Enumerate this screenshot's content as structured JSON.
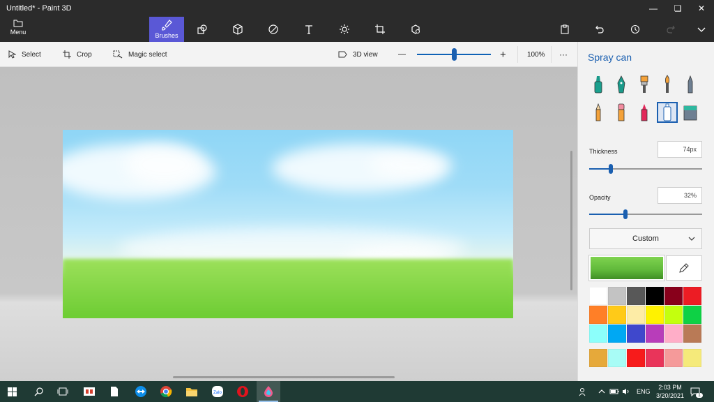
{
  "window": {
    "title": "Untitled* - Paint 3D",
    "controls": [
      "minimize",
      "restore",
      "close"
    ]
  },
  "ribbon": {
    "menu_label": "Menu",
    "active_tool_label": "Brushes",
    "tools": [
      "brush-icon",
      "2d-shapes-icon",
      "3d-shapes-icon",
      "stickers-icon",
      "text-icon",
      "effects-icon",
      "canvas-icon",
      "3d-library-icon"
    ],
    "right_tools": [
      "paste-icon",
      "undo-icon",
      "history-icon",
      "redo-icon",
      "expand-icon"
    ]
  },
  "subbar": {
    "select_label": "Select",
    "crop_label": "Crop",
    "magic_select_label": "Magic select",
    "view3d_label": "3D view",
    "zoom_minus": "—",
    "zoom_plus": "+",
    "zoom_level": "100%",
    "zoom_slider_fraction": 0.5,
    "more": "···"
  },
  "panel": {
    "title": "Spray can",
    "brushes": [
      "marker",
      "calligraphy-pen",
      "oil-brush",
      "watercolor",
      "pixel-pen",
      "pencil",
      "eraser",
      "crayon",
      "spray-can",
      "fill"
    ],
    "selected_brush": "spray-can",
    "thickness_label": "Thickness",
    "thickness_value": "74px",
    "thickness_fraction": 0.19,
    "opacity_label": "Opacity",
    "opacity_value": "32%",
    "opacity_fraction": 0.32,
    "color_mode": "Custom",
    "current_color": "#5fb83a",
    "palette": [
      "#ffffff",
      "#c3c3c3",
      "#585858",
      "#000000",
      "#88001b",
      "#ec1c24",
      "#ff7f27",
      "#ffca18",
      "#fdeca6",
      "#fff200",
      "#c4ff0e",
      "#0ed145",
      "#8cfffb",
      "#00a8f3",
      "#3f48cc",
      "#b83dba",
      "#ffaec8",
      "#b97a56"
    ],
    "custom_palette": [
      "#e6a93a",
      "#a8fcf6",
      "#f71b1b",
      "#e9345a",
      "#f59a9a",
      "#f5ea7a"
    ]
  },
  "taskbar": {
    "apps": [
      "windows-start-icon",
      "search-icon",
      "task-view-icon",
      "app-icon",
      "file-icon",
      "teamviewer-icon",
      "chrome-icon",
      "file-explorer-icon",
      "zalo-icon",
      "opera-icon",
      "paint3d-icon"
    ],
    "active_app": "paint3d-icon",
    "language": "ENG",
    "time": "2:03 PM",
    "date": "3/20/2021",
    "notification_count": "1"
  }
}
